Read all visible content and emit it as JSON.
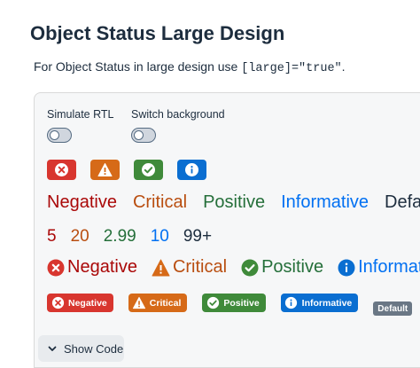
{
  "page": {
    "title": "Object Status Large Design",
    "description_prefix": "For Object Status in large design use ",
    "description_code": "[large]=\"true\"",
    "description_suffix": "."
  },
  "toggles": [
    {
      "label": "Simulate RTL",
      "checked": false
    },
    {
      "label": "Switch background",
      "checked": false
    }
  ],
  "inverted_icons": [
    {
      "state": "negative",
      "icon": "close-icon",
      "color": "#d8362f"
    },
    {
      "state": "critical",
      "icon": "warning-icon",
      "color": "#d66a18"
    },
    {
      "state": "positive",
      "icon": "checkmark-icon",
      "color": "#3f8a3a"
    },
    {
      "state": "information",
      "icon": "info-icon",
      "color": "#0a6ed1"
    }
  ],
  "text_statuses": {
    "negative": "Negative",
    "critical": "Critical",
    "positive": "Positive",
    "informative": "Informative",
    "default": "Default"
  },
  "number_statuses": {
    "negative": "5",
    "critical": "20",
    "positive": "2.99",
    "informative": "10",
    "default": "99+"
  },
  "icon_text_statuses": {
    "negative": "Negative",
    "critical": "Critical",
    "positive": "Positive",
    "informative": "Informative"
  },
  "inverted_badges": {
    "negative": "Negative",
    "critical": "Critical",
    "positive": "Positive",
    "informative": "Informative",
    "default": "Default"
  },
  "show_code": {
    "label": "Show Code",
    "icon": "chevron-down-icon"
  },
  "colors": {
    "negative_text": "#aa0808",
    "critical_text": "#b94e10",
    "positive_text": "#256f3a",
    "informative_text": "#0070f2",
    "negative_bg": "#d8362f",
    "critical_bg": "#d66a18",
    "positive_bg": "#3f8a3a",
    "informative_bg": "#0a6ed1"
  }
}
